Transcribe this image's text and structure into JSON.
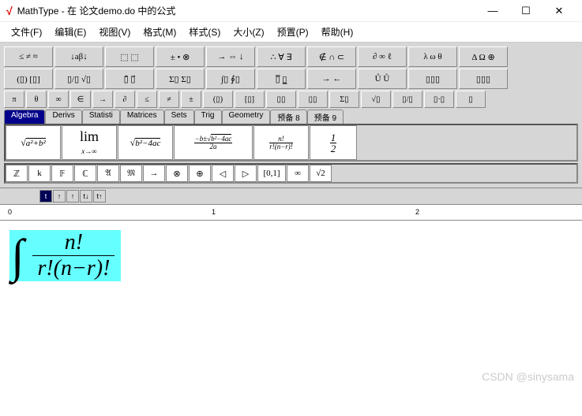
{
  "window": {
    "title": "MathType - 在 论文demo.do 中的公式"
  },
  "menu": [
    "文件(F)",
    "编辑(E)",
    "视图(V)",
    "格式(M)",
    "样式(S)",
    "大小(Z)",
    "预置(P)",
    "帮助(H)"
  ],
  "toolrow1": [
    "≤ ≠ ≈",
    "↓aβ↓",
    "⬚ ⬚",
    "± • ⊗",
    "→ ⇔ ↓",
    "∴ ∀ ∃",
    "∉ ∩ ⊂",
    "∂ ∞ ℓ",
    "λ ω θ",
    "Δ Ω ⊕"
  ],
  "toolrow2": [
    "(▯) [▯]",
    "▯/▯ √▯",
    "▯̄ ▯⃗",
    "Σ▯ Σ▯",
    "∫▯ ∮▯",
    "▯̅ ▯̲",
    "→ ←",
    "Ů Ů",
    "▯▯▯",
    "▯▯▯"
  ],
  "toolrow3": [
    "π",
    "θ",
    "∞",
    "∈",
    "→",
    "∂",
    "≤",
    "≠",
    "±",
    "(▯)",
    "[▯]",
    "▯▯",
    "▯▯",
    "Σ▯",
    "√▯",
    "▯/▯",
    "▯·▯",
    "▯"
  ],
  "tabs": [
    {
      "label": "Algebra",
      "active": true
    },
    {
      "label": "Derivs",
      "active": false
    },
    {
      "label": "Statisti",
      "active": false
    },
    {
      "label": "Matrices",
      "active": false
    },
    {
      "label": "Sets",
      "active": false
    },
    {
      "label": "Trig",
      "active": false
    },
    {
      "label": "Geometry",
      "active": false
    },
    {
      "label": "预备 8",
      "active": false
    },
    {
      "label": "预备 9",
      "active": false
    }
  ],
  "exprs": [
    {
      "tex": "\\sqrt{a^2+b^2}"
    },
    {
      "tex": "\\lim_{x\\to\\infty}"
    },
    {
      "tex": "\\sqrt{b^2-4ac}"
    },
    {
      "tex": "\\frac{-b\\pm\\sqrt{b^2-4ac}}{2a}"
    },
    {
      "tex": "\\frac{n!}{r!(n-r)!}"
    },
    {
      "tex": "\\frac{1}{2}"
    }
  ],
  "minis": [
    "ℤ",
    "k",
    "𝔽",
    "ℂ",
    "𝔄",
    "𝔐",
    "→",
    "⊗",
    "⊕",
    "◁",
    "▷",
    "[0,1]",
    "∞",
    "√2"
  ],
  "tabstrip": [
    "t",
    "↑",
    "↑",
    "t↓",
    "t↑"
  ],
  "ruler": {
    "marks": [
      "0",
      "1",
      "2"
    ]
  },
  "equation": {
    "type": "integral-fraction",
    "numerator": "n!",
    "denominator": "r!(n−r)!"
  },
  "watermark": "CSDN @sinysama"
}
